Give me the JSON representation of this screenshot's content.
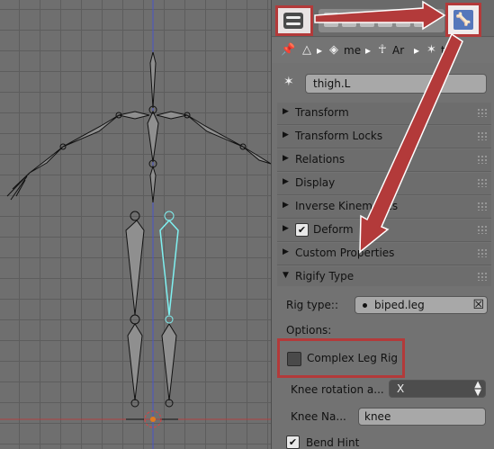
{
  "header": {
    "editor_type_icon": "properties-editor-icon",
    "context_tab_icons": [
      "render-icon",
      "layers-icon",
      "scene-icon",
      "world-icon",
      "object-icon",
      "constraint-icon",
      "modifier-icon"
    ],
    "bone_tab_icon": "bone-icon"
  },
  "breadcrumb": {
    "pin_icon": "pin-icon",
    "items": [
      {
        "icon": "mesh-icon",
        "label": "me"
      },
      {
        "icon": "armature-icon",
        "label": "Ar"
      },
      {
        "icon": "bone-icon",
        "label": "thi"
      }
    ]
  },
  "bone": {
    "name": "thigh.L"
  },
  "sections": [
    {
      "label": "Transform",
      "expanded": false
    },
    {
      "label": "Transform Locks",
      "expanded": false
    },
    {
      "label": "Relations",
      "expanded": false
    },
    {
      "label": "Display",
      "expanded": false
    },
    {
      "label": "Inverse Kinematics",
      "expanded": false
    },
    {
      "label": "Deform",
      "expanded": false,
      "checkbox": true
    },
    {
      "label": "Custom Properties",
      "expanded": false
    },
    {
      "label": "Rigify Type",
      "expanded": true
    }
  ],
  "rigify": {
    "rig_type_label": "Rig type::",
    "rig_type_value": "biped.leg",
    "options_label": "Options:",
    "complex_leg_rig_label": "Complex Leg Rig",
    "complex_leg_rig_checked": false,
    "knee_rotation_label": "Knee rotation a...",
    "knee_rotation_value": "X",
    "knee_name_label": "Knee Na...",
    "knee_name_value": "knee",
    "bend_hint_label": "Bend Hint",
    "bend_hint_checked": true
  },
  "colors": {
    "highlight_box": "#b33a3a",
    "selected_bone": "#7ff0f0",
    "active_tab": "#5577bb"
  }
}
